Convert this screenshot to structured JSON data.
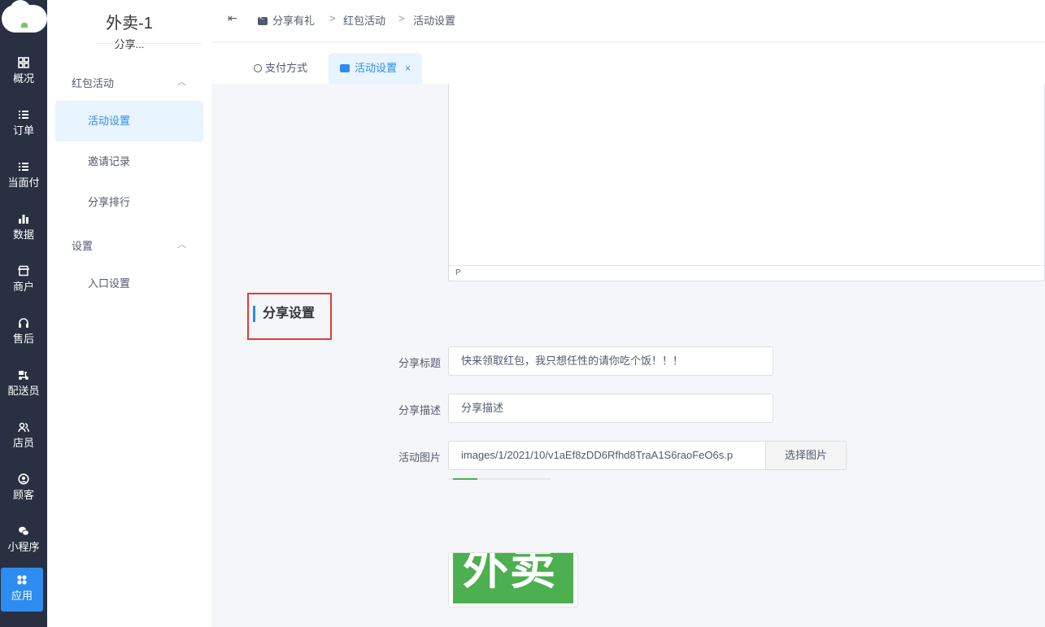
{
  "rail": {
    "items": [
      {
        "label": "概况",
        "icon": "grid-icon"
      },
      {
        "label": "订单",
        "icon": "list-icon"
      },
      {
        "label": "当面付",
        "icon": "list-icon"
      },
      {
        "label": "数据",
        "icon": "bar-chart-icon"
      },
      {
        "label": "商户",
        "icon": "store-icon"
      },
      {
        "label": "售后",
        "icon": "headset-icon"
      },
      {
        "label": "配送员",
        "icon": "scooter-icon"
      },
      {
        "label": "店员",
        "icon": "users-icon"
      },
      {
        "label": "顾客",
        "icon": "user-circle-icon"
      },
      {
        "label": "小程序",
        "icon": "wechat-icon"
      },
      {
        "label": "应用",
        "icon": "apps-icon"
      }
    ],
    "active_index": 10,
    "accent": "#2d8cf0"
  },
  "sidebar": {
    "shop_name": "外卖-1",
    "shop_sub": "分享...",
    "groups": [
      {
        "label": "红包活动",
        "items": [
          "活动设置",
          "邀请记录",
          "分享排行"
        ]
      },
      {
        "label": "设置",
        "items": [
          "入口设置"
        ]
      }
    ],
    "active_item": "活动设置"
  },
  "header": {
    "breadcrumb": [
      "分享有礼",
      "红包活动",
      "活动设置"
    ],
    "separator": ">"
  },
  "tabs": [
    {
      "label": "支付方式",
      "icon": "user-pay-icon",
      "active": false
    },
    {
      "label": "活动设置",
      "icon": "share-icon",
      "active": true,
      "close": "×"
    }
  ],
  "editor": {
    "status_text": "P"
  },
  "share_settings": {
    "title": "分享设置",
    "fields": {
      "share_title": {
        "label": "分享标题",
        "value": "快来领取红包，我只想任性的请你吃个饭！！！"
      },
      "share_desc": {
        "label": "分享描述",
        "value": "分享描述"
      },
      "activity_image": {
        "label": "活动图片",
        "value": "images/1/2021/10/v1aEf8zDD6Rfhd8TraA1S6raoFeO6s.p",
        "button": "选择图片"
      }
    },
    "preview_text": "外卖",
    "preview_color": "#4caf50"
  }
}
